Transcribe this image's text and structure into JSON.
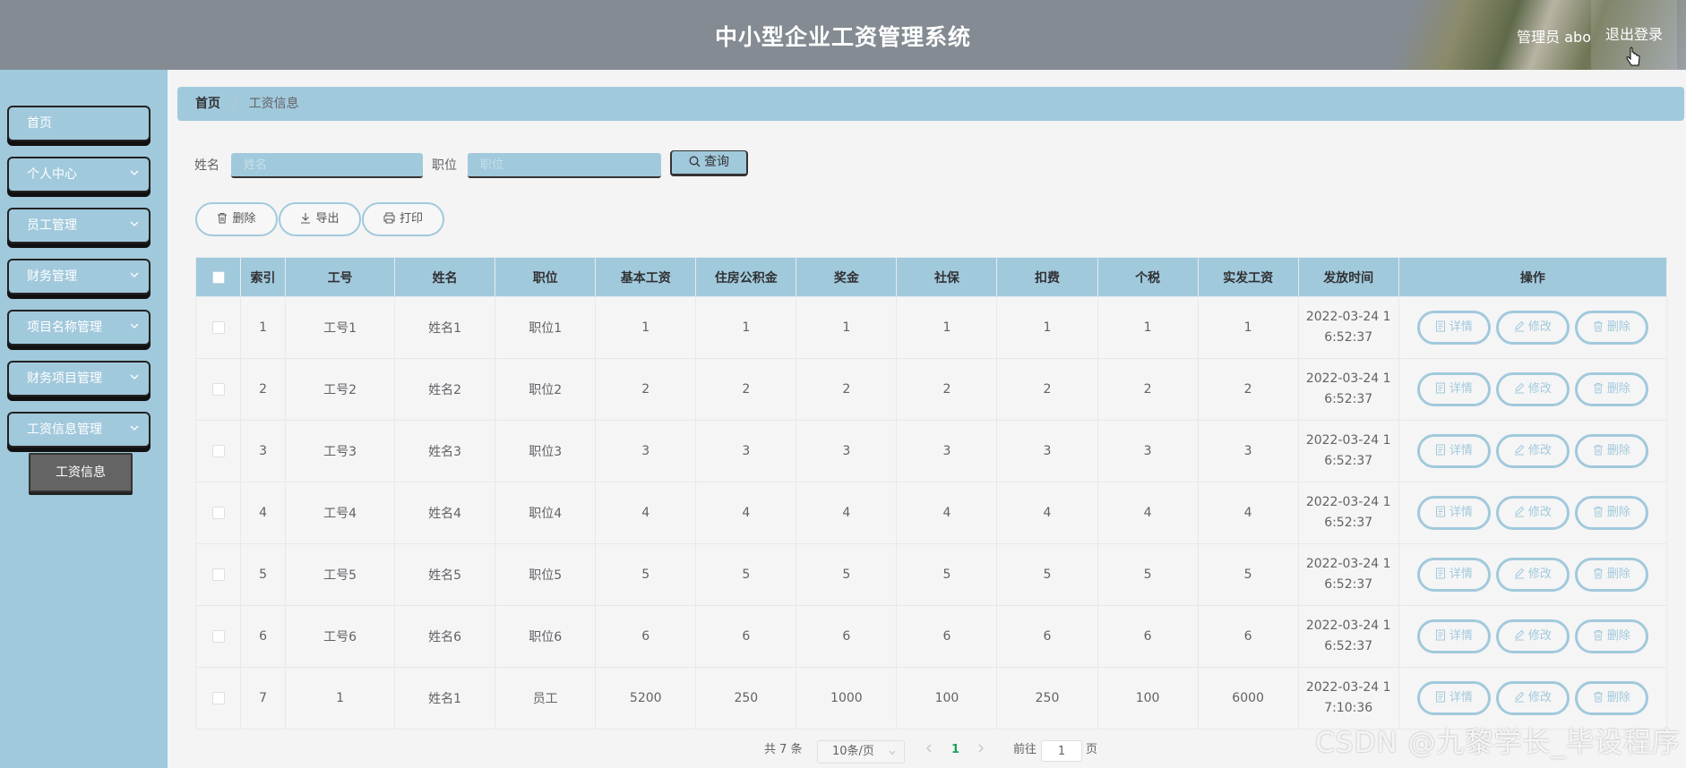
{
  "header": {
    "title": "中小型企业工资管理系统",
    "user": "管理员 abo",
    "logout": "退出登录"
  },
  "sidebar": {
    "items": [
      {
        "label": "首页",
        "icon": "none"
      },
      {
        "label": "个人中心",
        "icon": "chevron-down-icon"
      },
      {
        "label": "员工管理",
        "icon": "chevron-down-icon"
      },
      {
        "label": "财务管理",
        "icon": "chevron-down-icon"
      },
      {
        "label": "项目名称管理",
        "icon": "chevron-down-icon"
      },
      {
        "label": "财务项目管理",
        "icon": "chevron-down-icon"
      },
      {
        "label": "工资信息管理",
        "icon": "chevron-down-icon"
      }
    ],
    "sub_item": "工资信息"
  },
  "breadcrumb": {
    "home": "首页",
    "separator": "/",
    "current": "工资信息"
  },
  "search": {
    "name_label": "姓名",
    "name_placeholder": "姓名",
    "position_label": "职位",
    "position_placeholder": "职位",
    "button": "查询"
  },
  "actions": {
    "delete": "删除",
    "export": "导出",
    "print": "打印"
  },
  "table": {
    "columns": [
      "索引",
      "工号",
      "姓名",
      "职位",
      "基本工资",
      "住房公积金",
      "奖金",
      "社保",
      "扣费",
      "个税",
      "实发工资",
      "发放时间",
      "操作"
    ],
    "rows": [
      {
        "index": "1",
        "job_no": "工号1",
        "name": "姓名1",
        "position": "职位1",
        "base": "1",
        "fund": "1",
        "bonus": "1",
        "social": "1",
        "deduct": "1",
        "tax": "1",
        "net": "1",
        "time1": "2022-03-24 1",
        "time2": "6:52:37"
      },
      {
        "index": "2",
        "job_no": "工号2",
        "name": "姓名2",
        "position": "职位2",
        "base": "2",
        "fund": "2",
        "bonus": "2",
        "social": "2",
        "deduct": "2",
        "tax": "2",
        "net": "2",
        "time1": "2022-03-24 1",
        "time2": "6:52:37"
      },
      {
        "index": "3",
        "job_no": "工号3",
        "name": "姓名3",
        "position": "职位3",
        "base": "3",
        "fund": "3",
        "bonus": "3",
        "social": "3",
        "deduct": "3",
        "tax": "3",
        "net": "3",
        "time1": "2022-03-24 1",
        "time2": "6:52:37"
      },
      {
        "index": "4",
        "job_no": "工号4",
        "name": "姓名4",
        "position": "职位4",
        "base": "4",
        "fund": "4",
        "bonus": "4",
        "social": "4",
        "deduct": "4",
        "tax": "4",
        "net": "4",
        "time1": "2022-03-24 1",
        "time2": "6:52:37"
      },
      {
        "index": "5",
        "job_no": "工号5",
        "name": "姓名5",
        "position": "职位5",
        "base": "5",
        "fund": "5",
        "bonus": "5",
        "social": "5",
        "deduct": "5",
        "tax": "5",
        "net": "5",
        "time1": "2022-03-24 1",
        "time2": "6:52:37"
      },
      {
        "index": "6",
        "job_no": "工号6",
        "name": "姓名6",
        "position": "职位6",
        "base": "6",
        "fund": "6",
        "bonus": "6",
        "social": "6",
        "deduct": "6",
        "tax": "6",
        "net": "6",
        "time1": "2022-03-24 1",
        "time2": "6:52:37"
      },
      {
        "index": "7",
        "job_no": "1",
        "name": "姓名1",
        "position": "员工",
        "base": "5200",
        "fund": "250",
        "bonus": "1000",
        "social": "100",
        "deduct": "250",
        "tax": "100",
        "net": "6000",
        "time1": "2022-03-24 1",
        "time2": "7:10:36"
      }
    ],
    "row_actions": {
      "detail": "详情",
      "edit": "修改",
      "delete": "删除"
    }
  },
  "pagination": {
    "total": "共 7 条",
    "page_size": "10条/页",
    "current_page": "1",
    "goto_prefix": "前往",
    "goto_value": "1",
    "goto_suffix": "页"
  },
  "watermark": "CSDN @九黎学长_毕设程序",
  "colors": {
    "accent": "#a1c9dc",
    "header_bg": "#848b93",
    "active_submenu": "#646464",
    "page_bg": "#f4f4f4",
    "current_page": "#1aa35b"
  }
}
